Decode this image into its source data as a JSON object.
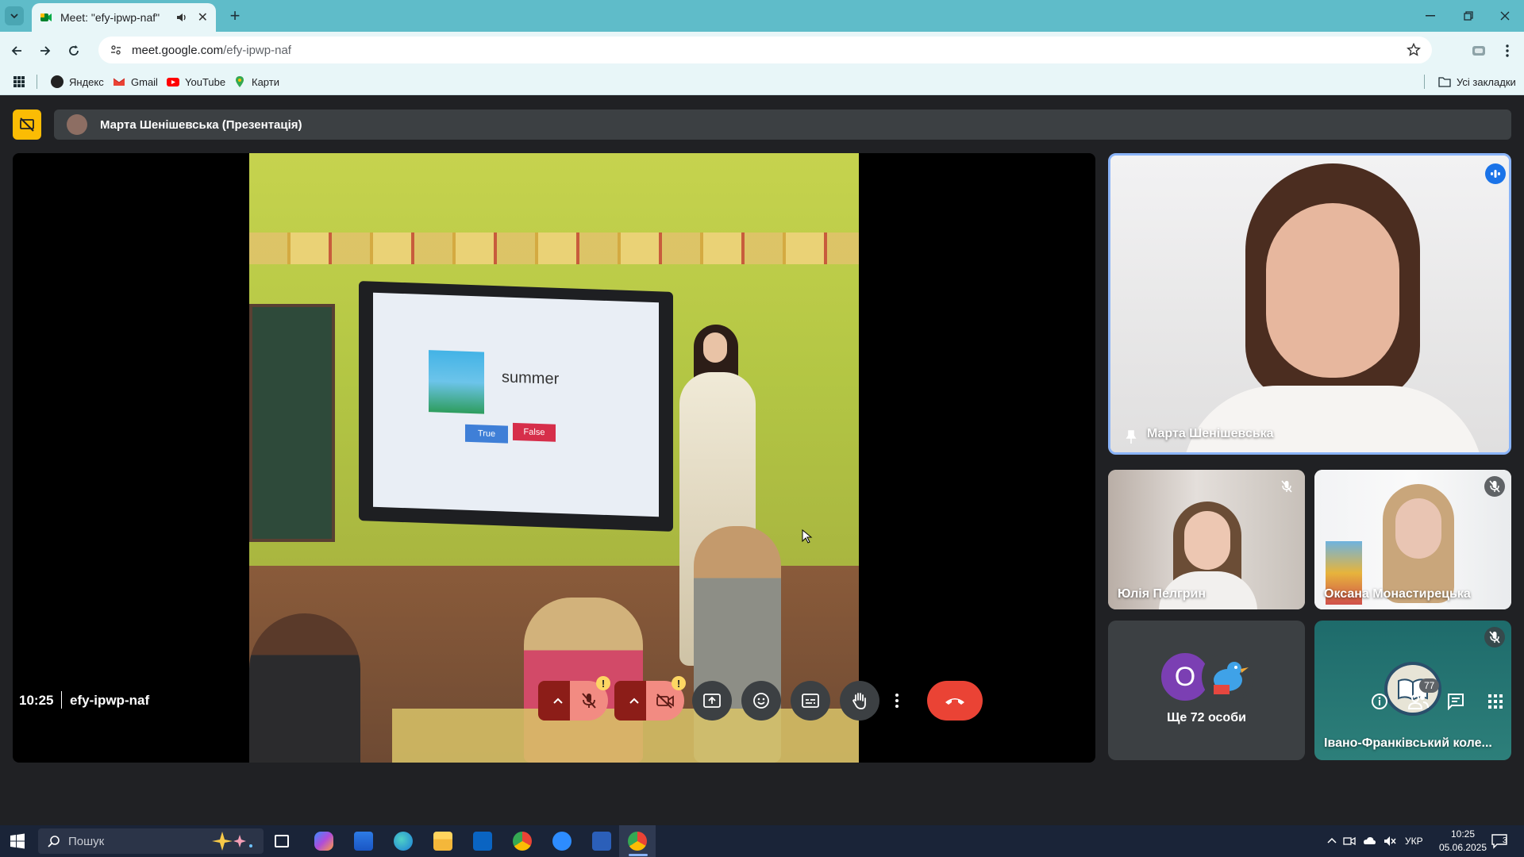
{
  "browser": {
    "tab_title": "Meet: \"efy-ipwp-naf\"",
    "url_host": "meet.google.com",
    "url_path": "/efy-ipwp-naf",
    "bookmarks": [
      "Яндекс",
      "Gmail",
      "YouTube",
      "Карти"
    ],
    "all_bookmarks": "Усі закладки"
  },
  "meet": {
    "presenter_bar": "Марта Шенішевська (Презентація)",
    "slide_word": "summer",
    "slide_true": "True",
    "slide_false": "False",
    "participants": [
      {
        "name": "Марта Шенішевська",
        "pinned": true
      },
      {
        "name": "Юлія Пелгрин",
        "muted": true
      },
      {
        "name": "Оксана Монастирецька",
        "muted": true
      },
      {
        "name": "Івано-Франківський коле...",
        "muted": true
      }
    ],
    "more_initial": "О",
    "more_label": "Ще 72 особи",
    "time": "10:25",
    "meeting_code": "efy-ipwp-naf",
    "people_count": "77",
    "accent_color": "#8ab4f8"
  },
  "taskbar": {
    "search_placeholder": "Пошук",
    "lang": "УКР",
    "time": "10:25",
    "date": "05.06.2025",
    "notif_count": "3"
  }
}
